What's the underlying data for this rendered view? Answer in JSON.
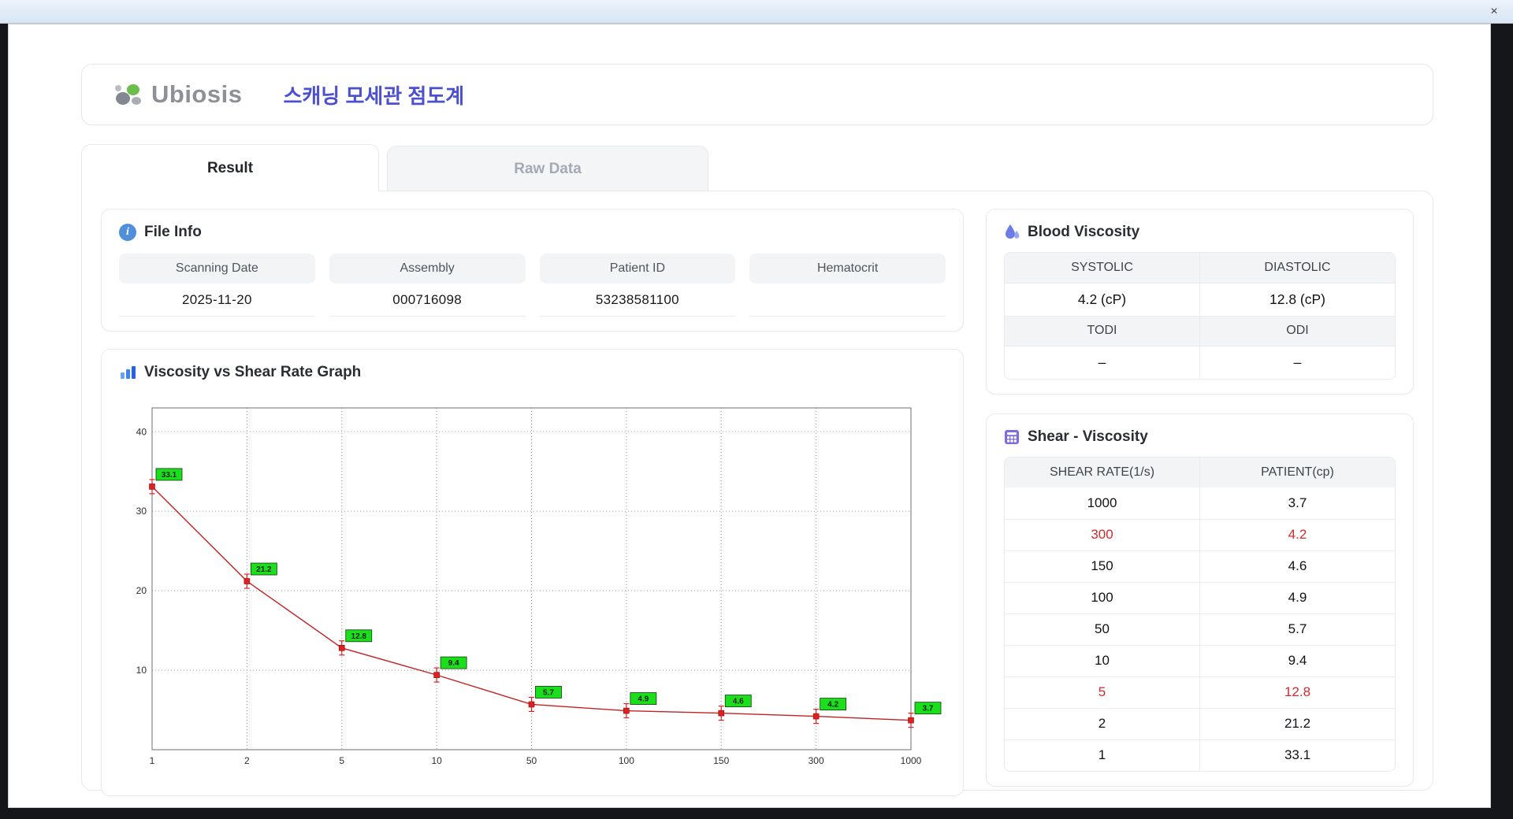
{
  "window": {
    "close_label": "×"
  },
  "header": {
    "logo_text": "Ubiosis",
    "title": "스캐닝 모세관 점도계"
  },
  "tabs": [
    {
      "label": "Result"
    },
    {
      "label": "Raw Data"
    }
  ],
  "file_info": {
    "title": "File Info",
    "fields": [
      {
        "label": "Scanning Date",
        "value": "2025-11-20"
      },
      {
        "label": "Assembly",
        "value": "000716098"
      },
      {
        "label": "Patient ID",
        "value": "53238581100"
      },
      {
        "label": "Hematocrit",
        "value": ""
      }
    ]
  },
  "blood_viscosity": {
    "title": "Blood Viscosity",
    "rows": [
      {
        "labels": [
          "SYSTOLIC",
          "DIASTOLIC"
        ],
        "values": [
          "4.2 (cP)",
          "12.8 (cP)"
        ]
      },
      {
        "labels": [
          "TODI",
          "ODI"
        ],
        "values": [
          "–",
          "–"
        ]
      }
    ]
  },
  "shear_viscosity": {
    "title": "Shear - Viscosity",
    "columns": [
      "SHEAR RATE(1/s)",
      "PATIENT(cp)"
    ],
    "rows": [
      {
        "rate": "1000",
        "value": "3.7",
        "highlight": false
      },
      {
        "rate": "300",
        "value": "4.2",
        "highlight": true
      },
      {
        "rate": "150",
        "value": "4.6",
        "highlight": false
      },
      {
        "rate": "100",
        "value": "4.9",
        "highlight": false
      },
      {
        "rate": "50",
        "value": "5.7",
        "highlight": false
      },
      {
        "rate": "10",
        "value": "9.4",
        "highlight": false
      },
      {
        "rate": "5",
        "value": "12.8",
        "highlight": true
      },
      {
        "rate": "2",
        "value": "21.2",
        "highlight": false
      },
      {
        "rate": "1",
        "value": "33.1",
        "highlight": false
      }
    ]
  },
  "chart_data": {
    "type": "line",
    "title": "Viscosity vs Shear Rate Graph",
    "x": [
      1,
      2,
      5,
      10,
      50,
      100,
      150,
      300,
      1000
    ],
    "x_tick_labels": [
      "1",
      "2",
      "5",
      "10",
      "50",
      "100",
      "150",
      "300",
      "1000"
    ],
    "values": [
      33.1,
      21.2,
      12.8,
      9.4,
      5.7,
      4.9,
      4.6,
      4.2,
      3.7
    ],
    "y_ticks": [
      10,
      20,
      30,
      40
    ],
    "ylim": [
      0,
      43
    ],
    "xlabel": "",
    "ylabel": "",
    "x_scale": "categorical (log-spaced shear rates, equal tick spacing)",
    "grid": "dotted",
    "line_color": "#c22222",
    "marker_color": "#e02020",
    "point_label_bg": "#1bdf1b"
  },
  "colors": {
    "accent": "#4b50cf",
    "highlight_red": "#cf2b2b",
    "header_gray": "#f3f4f6",
    "logo_green": "#6abf4b",
    "logo_gray": "#8d9097"
  }
}
